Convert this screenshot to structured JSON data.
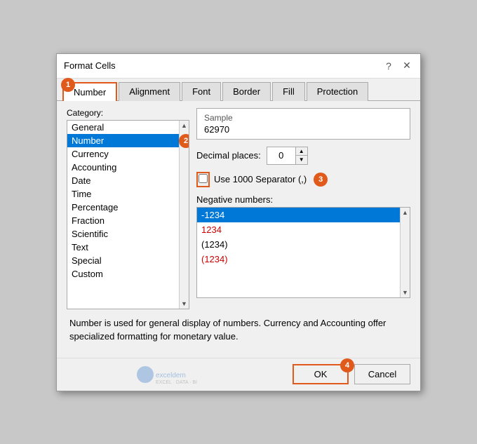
{
  "dialog": {
    "title": "Format Cells",
    "question_icon": "?",
    "close_icon": "✕"
  },
  "tabs": [
    {
      "label": "Number",
      "active": true
    },
    {
      "label": "Alignment",
      "active": false
    },
    {
      "label": "Font",
      "active": false
    },
    {
      "label": "Border",
      "active": false
    },
    {
      "label": "Fill",
      "active": false
    },
    {
      "label": "Protection",
      "active": false
    }
  ],
  "category": {
    "label": "Category:",
    "items": [
      {
        "label": "General",
        "selected": false
      },
      {
        "label": "Number",
        "selected": true
      },
      {
        "label": "Currency",
        "selected": false
      },
      {
        "label": "Accounting",
        "selected": false
      },
      {
        "label": "Date",
        "selected": false
      },
      {
        "label": "Time",
        "selected": false
      },
      {
        "label": "Percentage",
        "selected": false
      },
      {
        "label": "Fraction",
        "selected": false
      },
      {
        "label": "Scientific",
        "selected": false
      },
      {
        "label": "Text",
        "selected": false
      },
      {
        "label": "Special",
        "selected": false
      },
      {
        "label": "Custom",
        "selected": false
      }
    ]
  },
  "sample": {
    "label": "Sample",
    "value": "62970"
  },
  "decimal": {
    "label": "Decimal places:",
    "value": "0"
  },
  "separator": {
    "label": "Use 1000 Separator (,)",
    "checked": false
  },
  "negative_numbers": {
    "label": "Negative numbers:",
    "items": [
      {
        "label": "-1234",
        "type": "black",
        "selected": true
      },
      {
        "label": "1234",
        "type": "red",
        "selected": false
      },
      {
        "label": "(1234)",
        "type": "black",
        "selected": false
      },
      {
        "label": "(1234)",
        "type": "red",
        "selected": false
      }
    ]
  },
  "description": "Number is used for general display of numbers.  Currency and Accounting offer specialized formatting for monetary value.",
  "footer": {
    "ok_label": "OK",
    "cancel_label": "Cancel"
  },
  "badges": {
    "b1": "1",
    "b2": "2",
    "b3": "3",
    "b4": "4"
  }
}
